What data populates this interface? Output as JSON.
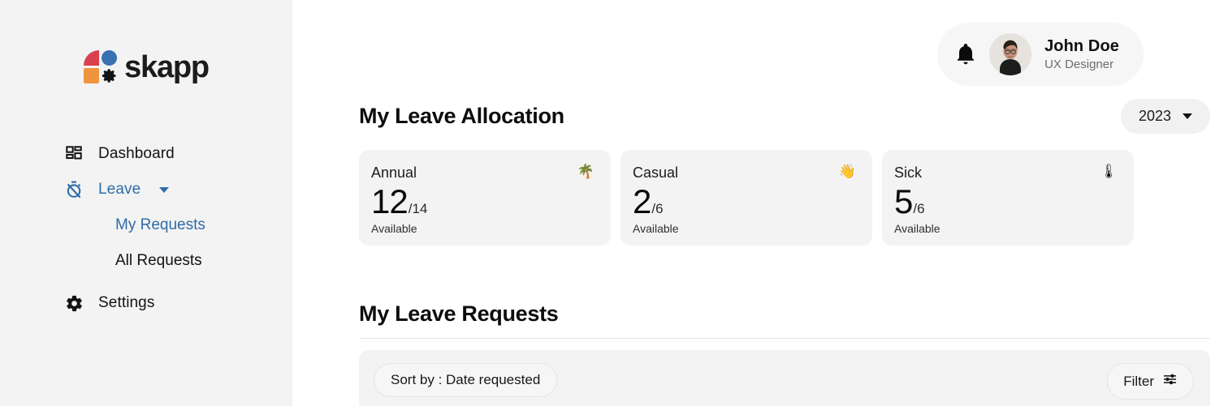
{
  "brand": {
    "name": "skapp",
    "colors": {
      "red": "#d9414f",
      "blue": "#3870b2",
      "orange": "#f0953f",
      "dark": "#1b1b1b"
    }
  },
  "sidebar": {
    "items": [
      {
        "label": "Dashboard",
        "icon": "grid-dashboard-icon",
        "active": false
      },
      {
        "label": "Leave",
        "icon": "timer-off-icon",
        "active": true
      },
      {
        "label": "Settings",
        "icon": "gear-icon",
        "active": false
      }
    ],
    "sub_items": [
      {
        "label": "My Requests",
        "active": true
      },
      {
        "label": "All Requests",
        "active": false
      }
    ]
  },
  "user": {
    "name": "John Doe",
    "role": "UX Designer",
    "bell_icon": "notification-bell-icon",
    "avatar_icon": "user-avatar"
  },
  "allocation": {
    "title": "My Leave Allocation",
    "year_selected": "2023",
    "cards": [
      {
        "title": "Annual",
        "emoji": "🌴",
        "emoji_name": "palm-tree-emoji",
        "available": "12",
        "total": "/14",
        "sub": "Available"
      },
      {
        "title": "Casual",
        "emoji": "👋",
        "emoji_name": "waving-hand-emoji",
        "available": "2",
        "total": "/6",
        "sub": "Available"
      },
      {
        "title": "Sick",
        "emoji": "🌡",
        "emoji_name": "thermometer-emoji",
        "available": "5",
        "total": "/6",
        "sub": "Available"
      }
    ]
  },
  "requests": {
    "title": "My Leave Requests",
    "sort_label": "Sort by : Date requested",
    "filter_label": "Filter"
  },
  "annotation": {
    "color": "#ff0000",
    "target": "year-dropdown"
  }
}
